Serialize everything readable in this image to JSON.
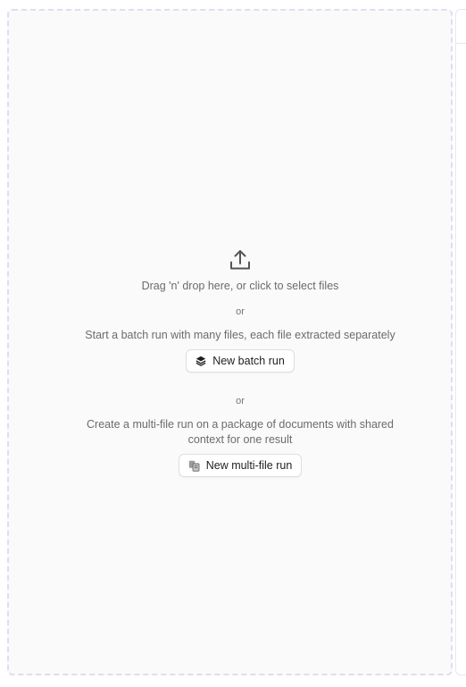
{
  "dropzone": {
    "drag_text": "Drag 'n' drop here, or click to select files",
    "or_1": "or",
    "batch_description": "Start a batch run with many files, each file extracted separately",
    "batch_button_label": "New batch run",
    "or_2": "or",
    "multi_description": "Create a multi-file run on a package of documents with shared context for one result",
    "multi_button_label": "New multi-file run",
    "icons": {
      "upload": "upload-icon",
      "batch": "stack-icon",
      "multi": "files-icon"
    },
    "colors": {
      "border": "#dcdff0",
      "background": "#fafafa",
      "text": "#6b6b6b",
      "button_text": "#1f1f1f"
    }
  }
}
